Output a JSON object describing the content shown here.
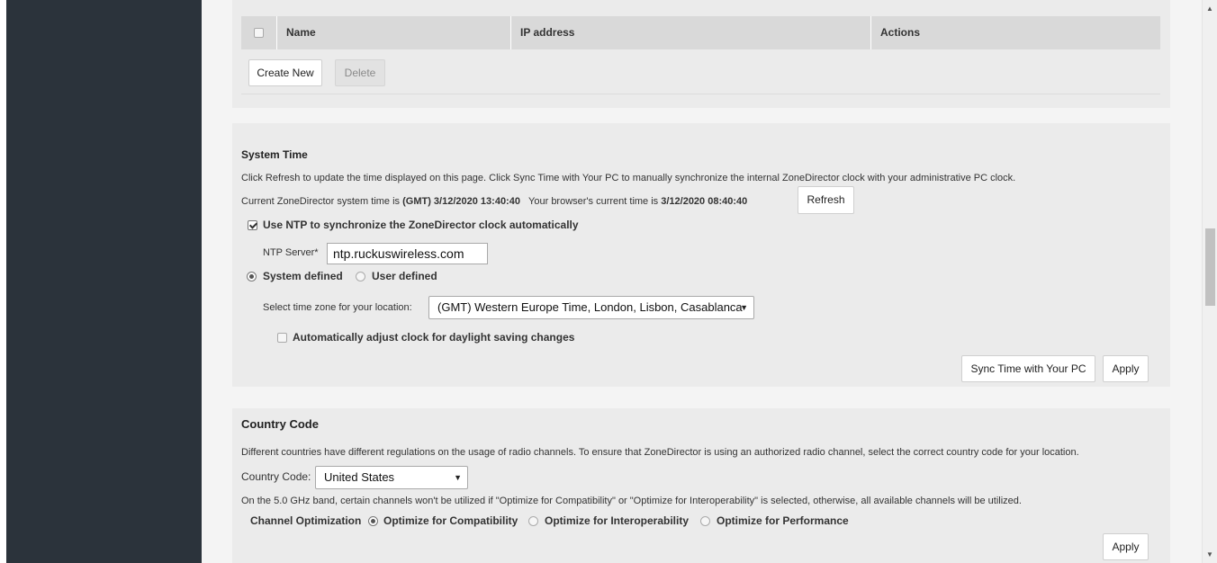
{
  "table": {
    "col_name": "Name",
    "col_ip": "IP address",
    "col_actions": "Actions",
    "create_new_label": "Create New",
    "delete_label": "Delete"
  },
  "system_time": {
    "title": "System Time",
    "description": "Click Refresh to update the time displayed on this page. Click Sync Time with Your PC to manually synchronize the internal ZoneDirector clock with your administrative PC clock.",
    "current_prefix": "Current ZoneDirector system time is",
    "current_value": "(GMT) 3/12/2020 13:40:40",
    "browser_prefix": "Your browser's current time is",
    "browser_value": "3/12/2020 08:40:40",
    "refresh_label": "Refresh",
    "ntp_checkbox_label": "Use NTP to synchronize the ZoneDirector clock automatically",
    "ntp_checked": true,
    "ntp_server_label": "NTP Server*",
    "ntp_server_value": "ntp.ruckuswireless.com",
    "system_defined_label": "System defined",
    "user_defined_label": "User defined",
    "selected_mode": "System defined",
    "timezone_label": "Select time zone for your location:",
    "timezone_value": "(GMT) Western Europe Time, London, Lisbon, Casablanca",
    "dst_label": "Automatically adjust clock for daylight saving changes",
    "dst_checked": false,
    "sync_label": "Sync Time with Your PC",
    "apply_label": "Apply"
  },
  "country_code": {
    "title": "Country Code",
    "description": "Different countries have different regulations on the usage of radio channels. To ensure that ZoneDirector is using an authorized radio channel, select the correct country code for your location.",
    "code_label": "Country Code:",
    "code_value": "United States",
    "band_note": "On the 5.0 GHz band, certain channels won't be utilized if \"Optimize for Compatibility\" or \"Optimize for Interoperability\" is selected, otherwise, all available channels will be utilized.",
    "channel_opt_label": "Channel Optimization",
    "opt_compat": "Optimize for Compatibility",
    "opt_interop": "Optimize for Interoperability",
    "opt_perf": "Optimize for Performance",
    "selected_opt": "Optimize for Compatibility",
    "apply_label": "Apply"
  }
}
